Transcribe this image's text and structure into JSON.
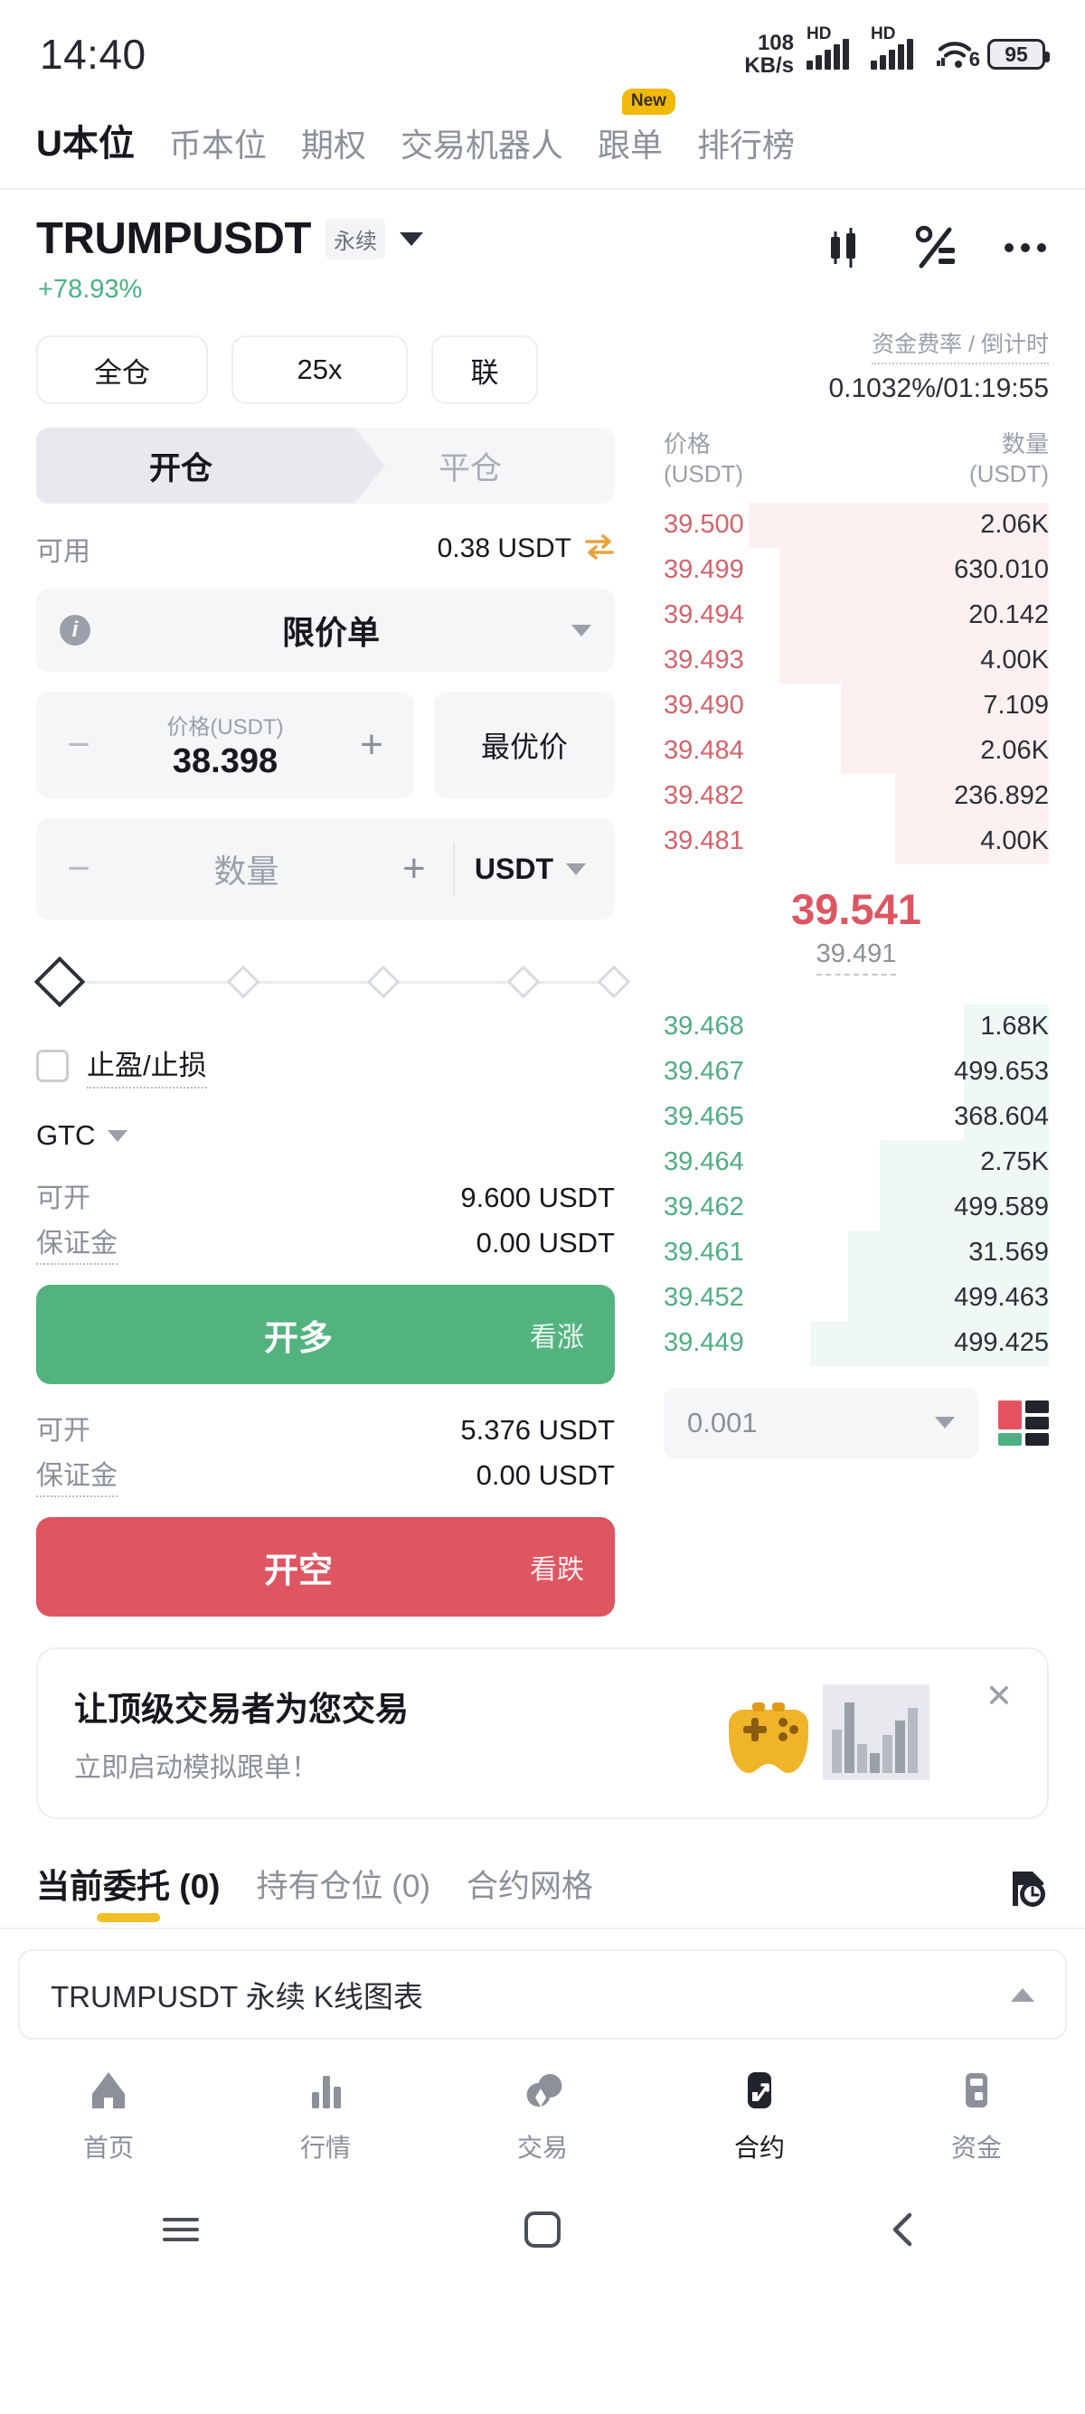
{
  "statusbar": {
    "time": "14:40",
    "network_speed": "108",
    "network_unit": "KB/s",
    "signal1_label": "HD",
    "signal2_label": "HD",
    "wifi_generation": "6",
    "battery": "95"
  },
  "top_tabs": [
    {
      "label": "U本位",
      "active": true,
      "badge": ""
    },
    {
      "label": "币本位",
      "active": false,
      "badge": ""
    },
    {
      "label": "期权",
      "active": false,
      "badge": ""
    },
    {
      "label": "交易机器人",
      "active": false,
      "badge": ""
    },
    {
      "label": "跟单",
      "active": false,
      "badge": "New"
    },
    {
      "label": "排行榜",
      "active": false,
      "badge": ""
    }
  ],
  "symbol": {
    "name": "TRUMPUSDT",
    "contract_type": "永续",
    "change_pct": "+78.93%",
    "change_color": "#49b183"
  },
  "margin_controls": {
    "margin_mode": "全仓",
    "leverage": "25x",
    "position_mode": "联"
  },
  "position_seg": {
    "open": "开仓",
    "close": "平仓",
    "active": "开仓"
  },
  "available": {
    "label": "可用",
    "value": "0.38 USDT"
  },
  "order_type": {
    "value": "限价单"
  },
  "price_input": {
    "caption": "价格(USDT)",
    "value": "38.398",
    "best_price_label": "最优价",
    "minus": "−",
    "plus": "+"
  },
  "qty_input": {
    "placeholder": "数量",
    "unit": "USDT",
    "minus": "−",
    "plus": "+"
  },
  "tpsl": {
    "label": "止盈/止损",
    "checked": false
  },
  "time_in_force": {
    "value": "GTC"
  },
  "long_block": {
    "avail_label": "可开",
    "avail_value": "9.600 USDT",
    "margin_label": "保证金",
    "margin_value": "0.00 USDT",
    "button_main": "开多",
    "button_sub": "看涨",
    "color": "#53b37f"
  },
  "short_block": {
    "avail_label": "可开",
    "avail_value": "5.376 USDT",
    "margin_label": "保证金",
    "margin_value": "0.00 USDT",
    "button_main": "开空",
    "button_sub": "看跌",
    "color": "#dd5662"
  },
  "funding": {
    "label": "资金费率 / 倒计时",
    "value": "0.1032%/01:19:55"
  },
  "orderbook": {
    "col_price": "价格",
    "col_price_unit": "(USDT)",
    "col_qty": "数量",
    "col_qty_unit": "(USDT)",
    "asks": [
      {
        "price": "39.500",
        "qty": "2.06K",
        "depth": 78
      },
      {
        "price": "39.499",
        "qty": "630.010",
        "depth": 70
      },
      {
        "price": "39.494",
        "qty": "20.142",
        "depth": 70
      },
      {
        "price": "39.493",
        "qty": "4.00K",
        "depth": 70
      },
      {
        "price": "39.490",
        "qty": "7.109",
        "depth": 54
      },
      {
        "price": "39.484",
        "qty": "2.06K",
        "depth": 54
      },
      {
        "price": "39.482",
        "qty": "236.892",
        "depth": 40
      },
      {
        "price": "39.481",
        "qty": "4.00K",
        "depth": 40
      }
    ],
    "last_price": "39.541",
    "mark_price": "39.491",
    "bids": [
      {
        "price": "39.468",
        "qty": "1.68K",
        "depth": 22
      },
      {
        "price": "39.467",
        "qty": "499.653",
        "depth": 22
      },
      {
        "price": "39.465",
        "qty": "368.604",
        "depth": 22
      },
      {
        "price": "39.464",
        "qty": "2.75K",
        "depth": 44
      },
      {
        "price": "39.462",
        "qty": "499.589",
        "depth": 44
      },
      {
        "price": "39.461",
        "qty": "31.569",
        "depth": 52
      },
      {
        "price": "39.452",
        "qty": "499.463",
        "depth": 52
      },
      {
        "price": "39.449",
        "qty": "499.425",
        "depth": 62
      }
    ],
    "tick_size": "0.001",
    "ask_color": "#d4636b",
    "bid_color": "#4fae82"
  },
  "banner": {
    "title": "让顶级交易者为您交易",
    "subtitle": "立即启动模拟跟单！",
    "close": "✕"
  },
  "order_tabs": [
    {
      "label": "当前委托 (0)",
      "active": true
    },
    {
      "label": "持有仓位 (0)",
      "active": false
    },
    {
      "label": "合约网格",
      "active": false
    }
  ],
  "kline_bar": {
    "label": "TRUMPUSDT 永续 K线图表"
  },
  "bottom_nav": [
    {
      "label": "首页",
      "icon": "home-icon",
      "active": false
    },
    {
      "label": "行情",
      "icon": "markets-icon",
      "active": false
    },
    {
      "label": "交易",
      "icon": "trade-icon",
      "active": false
    },
    {
      "label": "合约",
      "icon": "futures-icon",
      "active": true
    },
    {
      "label": "资金",
      "icon": "wallet-icon",
      "active": false
    }
  ],
  "system_nav": {
    "menu": "menu-icon",
    "home": "home-square-icon",
    "back": "back-icon"
  }
}
